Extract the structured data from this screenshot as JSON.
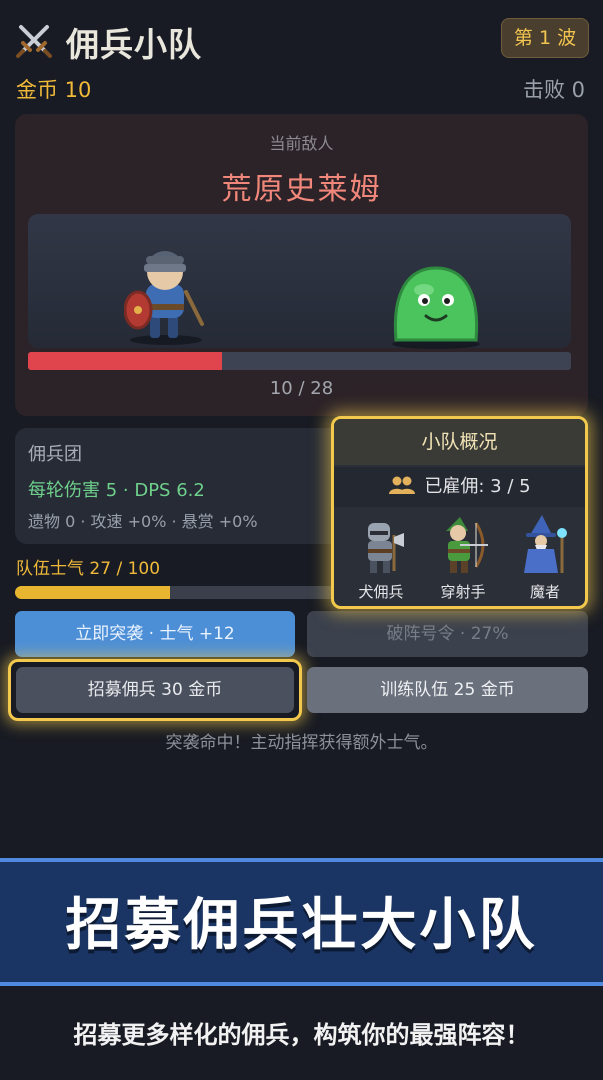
{
  "header": {
    "title": "佣兵小队",
    "title_icon": "crossed-swords-icon",
    "wave": "第 1 波",
    "gold": "金币  10",
    "kills": "击败  0"
  },
  "enemy": {
    "caption": "当前敌人",
    "name": "荒原史莱姆",
    "hp_text": "10 / 28",
    "hp_fraction": 0.357
  },
  "mercenaries": {
    "title": "佣兵团",
    "damage": "每轮伤害 5  ·  DPS 6.2",
    "extra": "遗物 0 · 攻速 +0% · 悬赏 +0%"
  },
  "morale": {
    "label": "队伍士气  27 / 100",
    "fraction": 0.27
  },
  "buttons": {
    "raid": "立即突袭 · 士气 +12",
    "break": "破阵号令 · 27%",
    "recruit": "招募佣兵  30 金币",
    "train": "训练队伍  25 金币"
  },
  "hint": "突袭命中！主动指挥获得额外士气。",
  "squad": {
    "title": "小队概况",
    "hired": "已雇佣: 3 / 5",
    "units": [
      {
        "name": "犬佣兵",
        "icon": "knight-icon"
      },
      {
        "name": "穿射手",
        "icon": "archer-icon"
      },
      {
        "name": "魔者",
        "icon": "wizard-icon"
      }
    ]
  },
  "promo": {
    "banner": "招募佣兵壮大小队",
    "subtitle": "招募更多样化的佣兵，构筑你的最强阵容！"
  },
  "colors": {
    "gold": "#f0b93a",
    "hp": "#e0454d",
    "morale": "#e7b52f",
    "raid_button": "#4d8fd6",
    "highlight": "#f2c94c"
  }
}
